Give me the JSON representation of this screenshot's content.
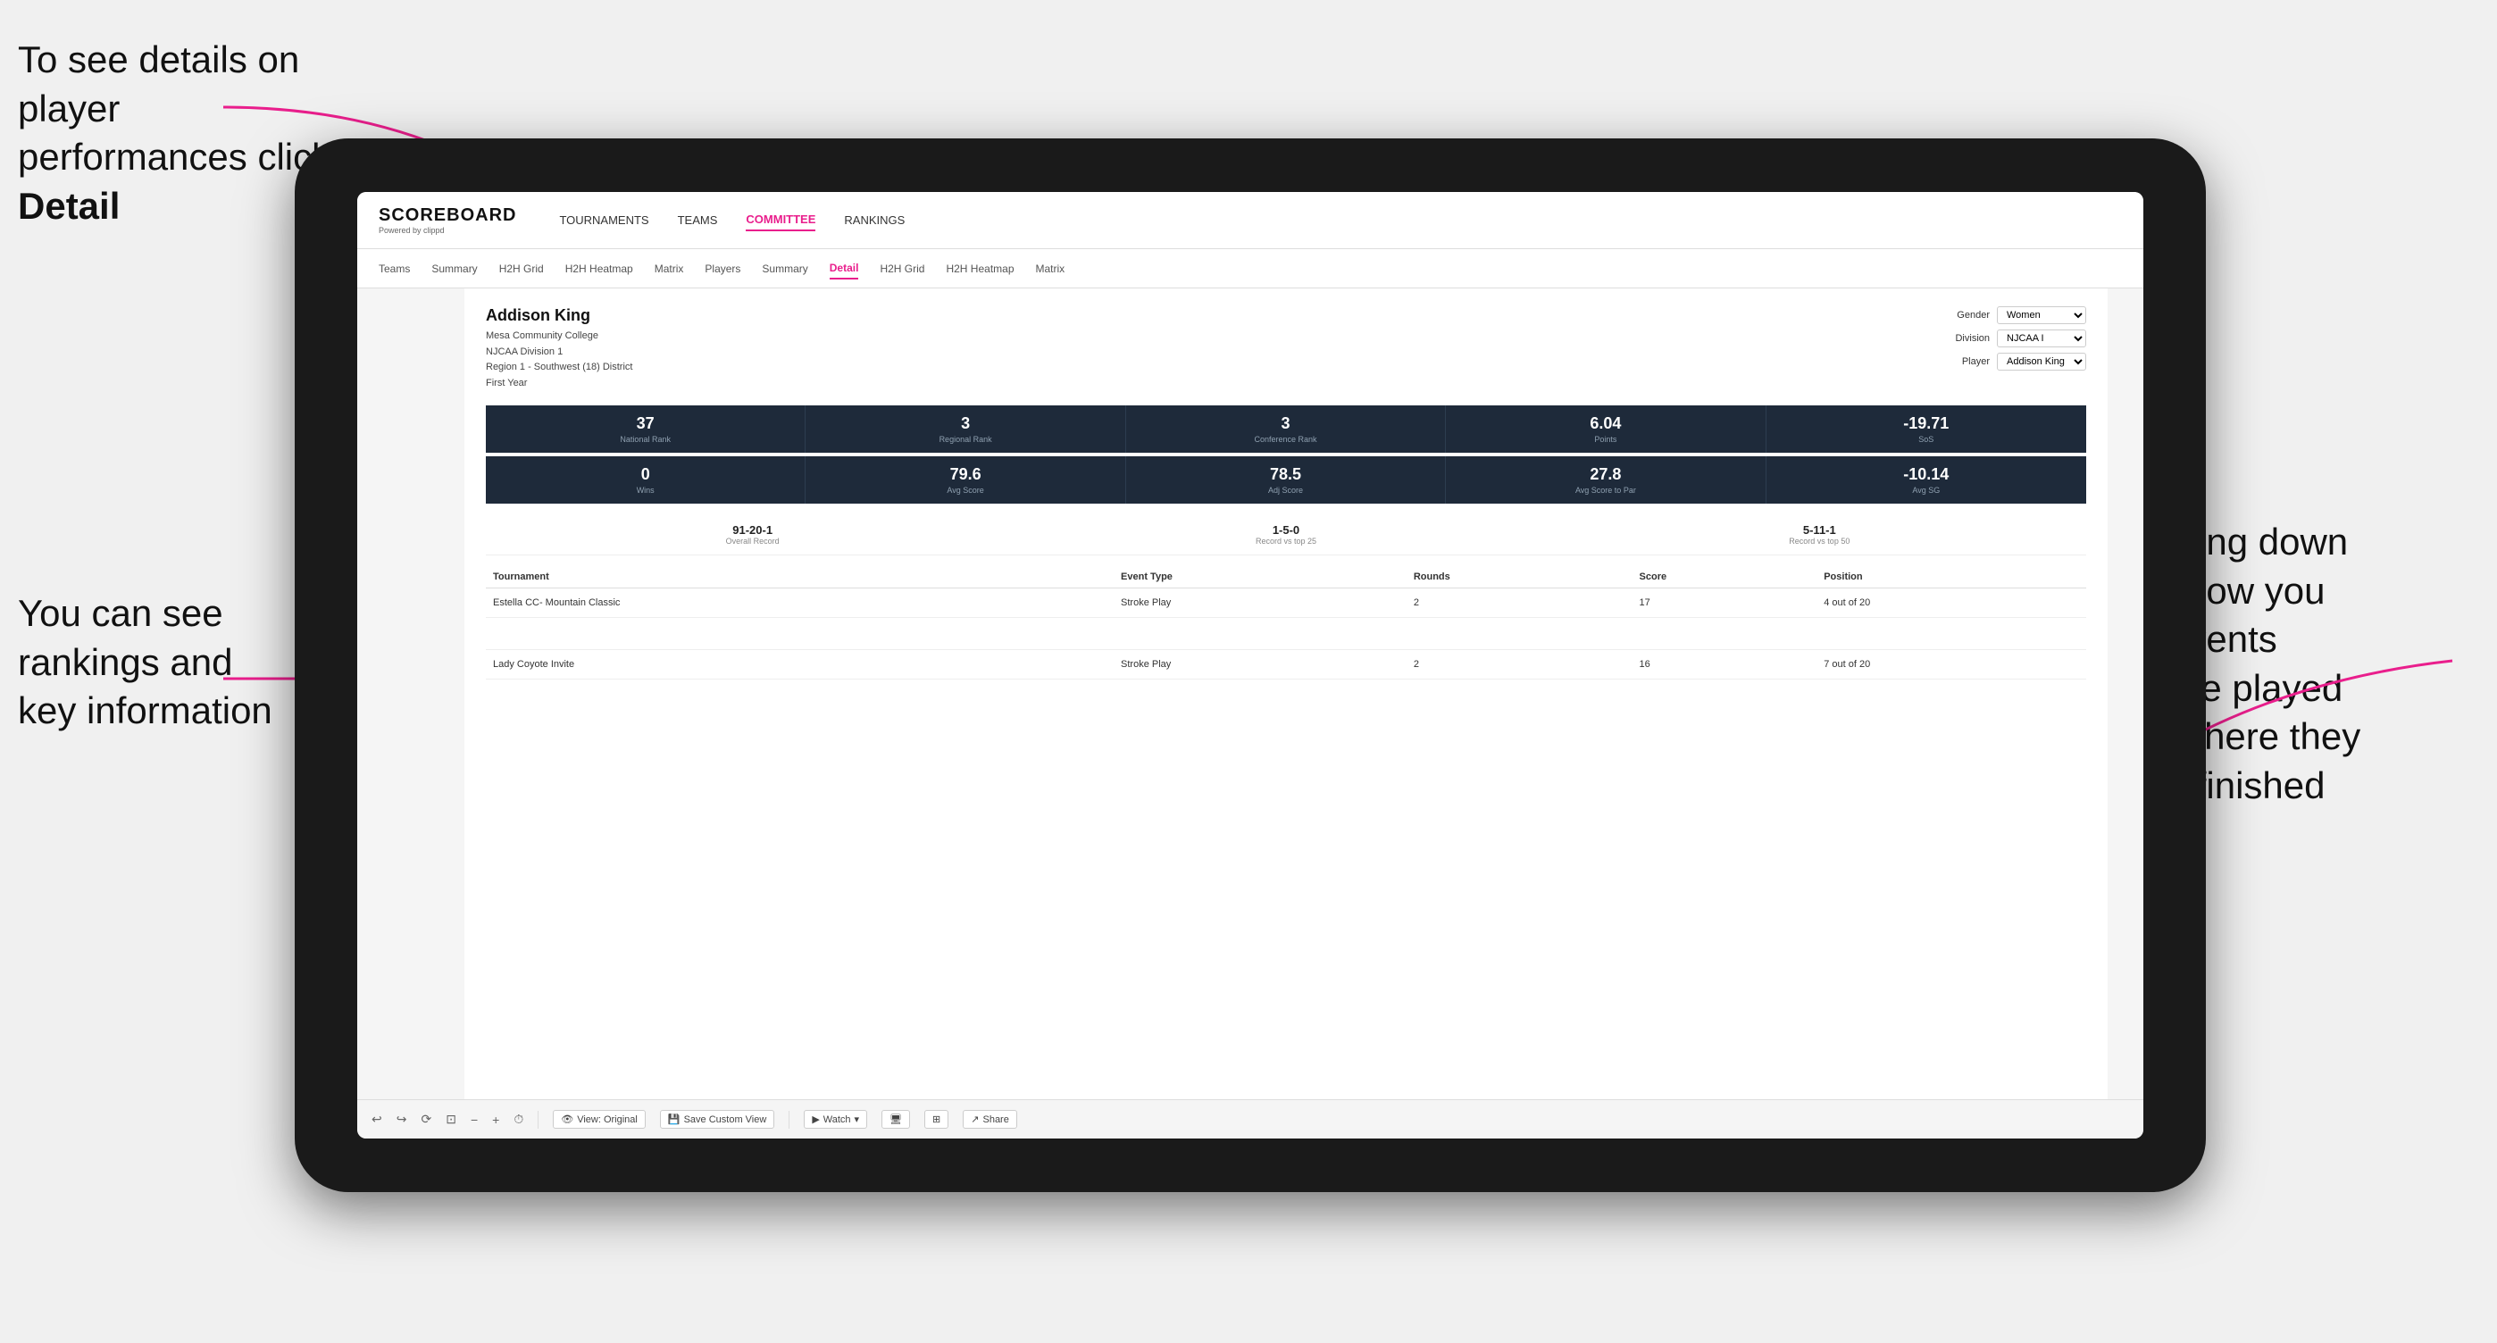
{
  "annotations": {
    "top_left": "To see details on player performances click ",
    "top_left_bold": "Detail",
    "bottom_left_line1": "You can see",
    "bottom_left_line2": "rankings and",
    "bottom_left_line3": "key information",
    "right_line1": "Scrolling down",
    "right_line2": "will show you",
    "right_line3": "the events",
    "right_line4": "they've played",
    "right_line5": "and where they",
    "right_line6": "have finished"
  },
  "nav": {
    "logo": "SCOREBOARD",
    "logo_sub": "Powered by clippd",
    "items": [
      "TOURNAMENTS",
      "TEAMS",
      "COMMITTEE",
      "RANKINGS"
    ],
    "active": "COMMITTEE"
  },
  "subnav": {
    "items": [
      "Teams",
      "Summary",
      "H2H Grid",
      "H2H Heatmap",
      "Matrix",
      "Players",
      "Summary",
      "Detail",
      "H2H Grid",
      "H2H Heatmap",
      "Matrix"
    ],
    "active": "Detail"
  },
  "player": {
    "name": "Addison King",
    "college": "Mesa Community College",
    "division": "NJCAA Division 1",
    "region": "Region 1 - Southwest (18) District",
    "year": "First Year",
    "gender_label": "Gender",
    "gender_value": "Women",
    "division_label": "Division",
    "division_value": "NJCAA I",
    "player_label": "Player",
    "player_value": "Addison King"
  },
  "stats_row1": [
    {
      "value": "37",
      "label": "National Rank"
    },
    {
      "value": "3",
      "label": "Regional Rank"
    },
    {
      "value": "3",
      "label": "Conference Rank"
    },
    {
      "value": "6.04",
      "label": "Points"
    },
    {
      "value": "-19.71",
      "label": "SoS"
    }
  ],
  "stats_row2": [
    {
      "value": "0",
      "label": "Wins"
    },
    {
      "value": "79.6",
      "label": "Avg Score"
    },
    {
      "value": "78.5",
      "label": "Adj Score"
    },
    {
      "value": "27.8",
      "label": "Avg Score to Par"
    },
    {
      "value": "-10.14",
      "label": "Avg SG"
    }
  ],
  "records": [
    {
      "value": "91-20-1",
      "label": "Overall Record"
    },
    {
      "value": "1-5-0",
      "label": "Record vs top 25"
    },
    {
      "value": "5-11-1",
      "label": "Record vs top 50"
    }
  ],
  "table": {
    "headers": [
      "Tournament",
      "Event Type",
      "Rounds",
      "Score",
      "Position"
    ],
    "rows": [
      {
        "tournament": "Estella CC- Mountain Classic",
        "event_type": "Stroke Play",
        "rounds": "2",
        "score": "17",
        "position": "4 out of 20"
      },
      {
        "tournament": "",
        "event_type": "",
        "rounds": "",
        "score": "",
        "position": ""
      },
      {
        "tournament": "Lady Coyote Invite",
        "event_type": "Stroke Play",
        "rounds": "2",
        "score": "16",
        "position": "7 out of 20"
      }
    ]
  },
  "toolbar": {
    "view_label": "View: Original",
    "save_label": "Save Custom View",
    "watch_label": "Watch",
    "share_label": "Share"
  }
}
